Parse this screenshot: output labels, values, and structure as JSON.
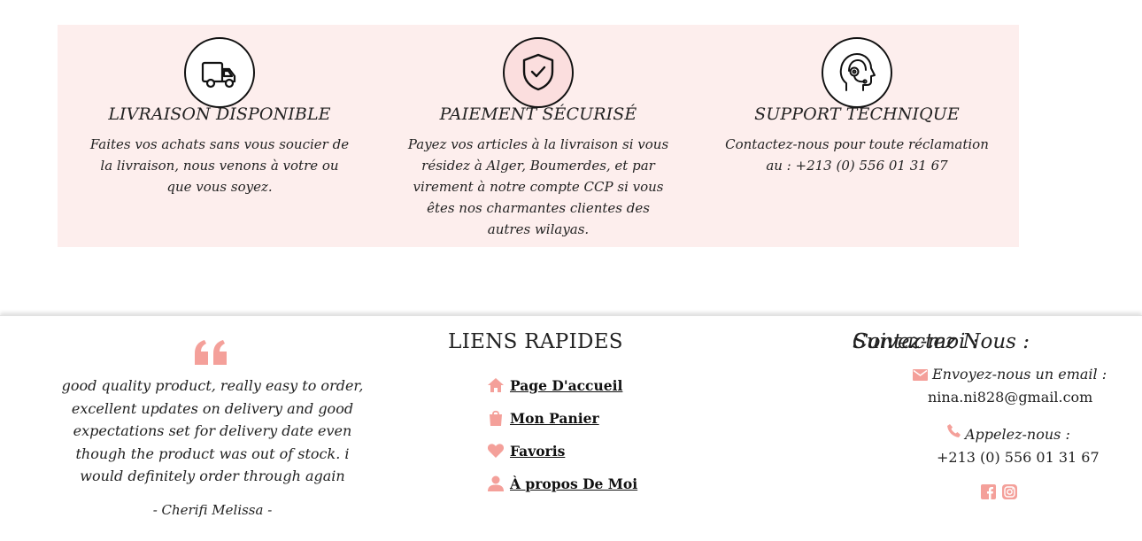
{
  "features": [
    {
      "icon": "delivery-truck-icon",
      "title": "LIVRAISON DISPONIBLE",
      "text": "Faites vos achats sans vous soucier de la livraison, nous venons à votre ou que vous soyez."
    },
    {
      "icon": "shield-check-icon",
      "title": "PAIEMENT SÉCURISÉ",
      "text": "Payez vos articles à la livraison si vous résidez à Alger, Boumerdes, et par virement à notre compte CCP si vous êtes nos charmantes clientes des autres wilayas."
    },
    {
      "icon": "headset-support-icon",
      "title": "SUPPORT TECHNIQUE",
      "text": "Contactez-nous pour toute réclamation au : +213 (0) 556 01 31 67"
    }
  ],
  "testimonial": {
    "icon": "quote-icon",
    "text": "good quality product, really easy to order, excellent updates on delivery and good expectations set for delivery date even though the product was out of stock. i would definitely order through again",
    "author": "- Cherifi Melissa -"
  },
  "quick_links": {
    "title": "LIENS RAPIDES",
    "items": [
      {
        "icon": "home-icon",
        "label": " Page D'accueil"
      },
      {
        "icon": "shopping-bag-icon",
        "label": " Mon Panier"
      },
      {
        "icon": "heart-icon",
        "label": "Favoris"
      },
      {
        "icon": "user-icon",
        "label": "À propos De Moi"
      }
    ]
  },
  "contact": {
    "title": "Contactez Nous :",
    "email_label": "Envoyez-nous un email :",
    "email": "nina.ni828@gmail.com",
    "phone_label": "Appelez-nous :",
    "phone": "+213 (0) 556 01 31 67",
    "social_title": "Suivez-moi :",
    "social": [
      {
        "icon": "facebook-icon"
      },
      {
        "icon": "instagram-icon"
      }
    ]
  },
  "colors": {
    "accent": "#f4a09a",
    "feature_bg": "#fdeeed",
    "text": "#222222"
  }
}
